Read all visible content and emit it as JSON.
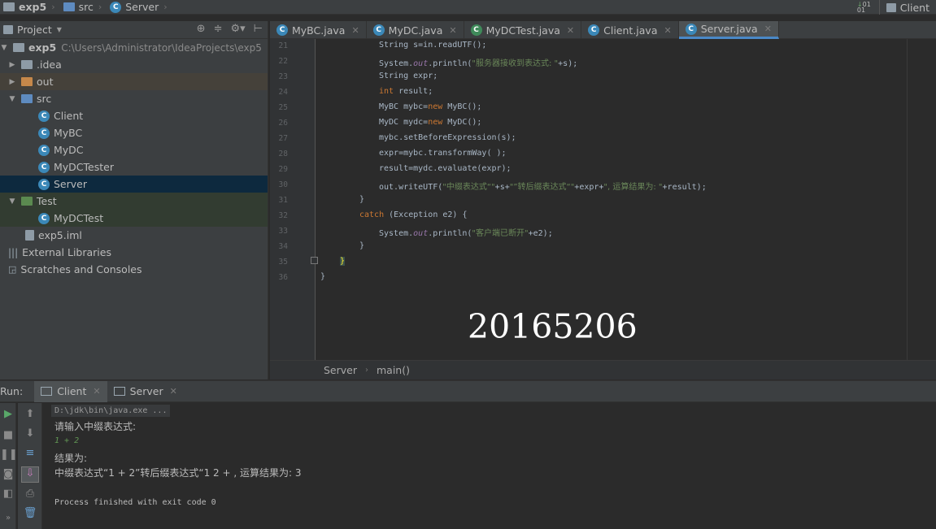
{
  "navbar": {
    "crumbs": [
      "exp5",
      "src",
      "Server"
    ],
    "run_config": "Client"
  },
  "project": {
    "title": "Project",
    "tree": [
      {
        "label": "exp5",
        "path": "C:\\Users\\Administrator\\IdeaProjects\\exp5"
      },
      {
        "label": ".idea"
      },
      {
        "label": "out"
      },
      {
        "label": "src"
      },
      {
        "label": "Client"
      },
      {
        "label": "MyBC"
      },
      {
        "label": "MyDC"
      },
      {
        "label": "MyDCTester"
      },
      {
        "label": "Server"
      },
      {
        "label": "Test"
      },
      {
        "label": "MyDCTest"
      },
      {
        "label": "exp5.iml"
      },
      {
        "label": "External Libraries"
      },
      {
        "label": "Scratches and Consoles"
      }
    ]
  },
  "tabs": [
    {
      "label": "MyBC.java"
    },
    {
      "label": "MyDC.java"
    },
    {
      "label": "MyDCTest.java"
    },
    {
      "label": "Client.java"
    },
    {
      "label": "Server.java"
    }
  ],
  "editor": {
    "line_numbers": [
      "21",
      "22",
      "23",
      "24",
      "25",
      "26",
      "27",
      "28",
      "29",
      "30",
      "31",
      "32",
      "33",
      "34",
      "35",
      "36"
    ],
    "code": {
      "l21": "String s=in.readUTF();",
      "l22_a": "System.",
      "l22_b": "out",
      "l22_c": ".println(",
      "l22_d": "\"服务器接收到表达式: \"",
      "l22_e": "+s);",
      "l23": "String expr;",
      "l24_a": "int",
      "l24_b": " result;",
      "l25_a": "MyBC mybc=",
      "l25_b": "new",
      "l25_c": " MyBC();",
      "l26_a": "MyDC mydc=",
      "l26_b": "new",
      "l26_c": " MyDC();",
      "l27": "mybc.setBeforeExpression(s);",
      "l28": "expr=mybc.transformWay( );",
      "l29": "result=mydc.evaluate(expr);",
      "l30_a": "out.writeUTF(",
      "l30_b": "\"中缀表达式“\"",
      "l30_c": "+s+",
      "l30_d": "\"”转后缀表达式“\"",
      "l30_e": "+expr+",
      "l30_f": "\", 运算结果为: \"",
      "l30_g": "+result);",
      "l31": "}",
      "l32_a": "catch",
      "l32_b": " (Exception e2) {",
      "l33_a": "System.",
      "l33_b": "out",
      "l33_c": ".println(",
      "l33_d": "\"客户端已断开\"",
      "l33_e": "+e2);",
      "l34": "}",
      "l35": "}",
      "l36": "}"
    },
    "watermark": "20165206"
  },
  "editor_breadcrumb": [
    "Server",
    "main()"
  ],
  "run": {
    "label": "Run:",
    "tabs": [
      {
        "label": "Client"
      },
      {
        "label": "Server"
      }
    ],
    "console": {
      "cmd": "D:\\jdk\\bin\\java.exe ...",
      "prompt": "请输入中缀表达式:",
      "input": "1 + 2",
      "result_label": "结果为:",
      "result": "中缀表达式“1 + 2”转后缀表达式“1 2 + , 运算结果为: 3",
      "exit": "Process finished with exit code 0"
    }
  },
  "colors": {
    "keyword": "#cc7832",
    "string": "#6a8759",
    "field": "#9876aa",
    "active_tab_underline": "#4a88c7",
    "input_green": "#629755"
  }
}
